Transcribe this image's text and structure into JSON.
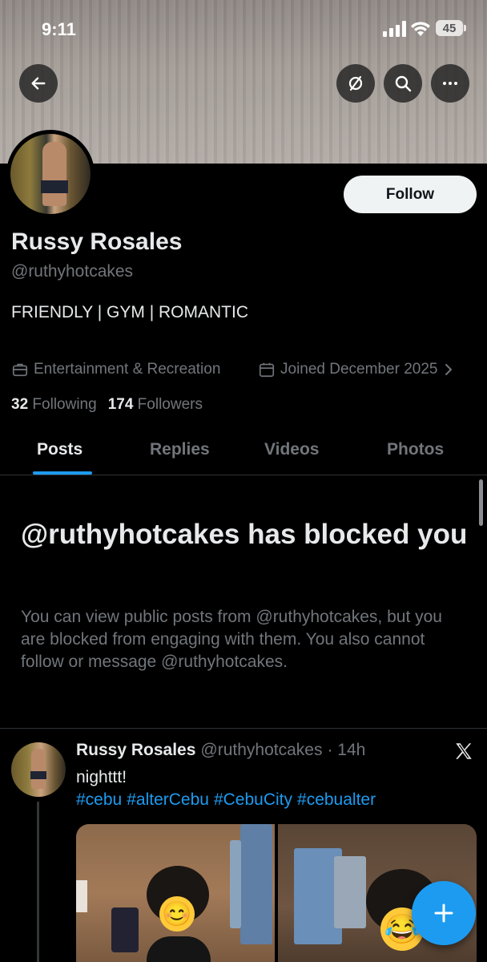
{
  "status_bar": {
    "time": "9:11",
    "battery": "45"
  },
  "profile": {
    "name": "Russy Rosales",
    "handle": "@ruthyhotcakes",
    "bio": "FRIENDLY | GYM | ROMANTIC",
    "category": "Entertainment & Recreation",
    "joined": "Joined December 2025",
    "following_count": "32",
    "following_label": "Following",
    "followers_count": "174",
    "followers_label": "Followers",
    "follow_button": "Follow"
  },
  "tabs": [
    {
      "label": "Posts",
      "active": true
    },
    {
      "label": "Replies",
      "active": false
    },
    {
      "label": "Videos",
      "active": false
    },
    {
      "label": "Photos",
      "active": false
    }
  ],
  "blocked_notice": {
    "title": "@ruthyhotcakes has blocked you",
    "description": "You can view public posts from @ruthyhotcakes, but you are blocked from engaging with them. You also cannot follow or message @ruthyhotcakes."
  },
  "post": {
    "name": "Russy Rosales",
    "handle": "@ruthyhotcakes",
    "time": "· 14h",
    "text": "nighttt!",
    "hashtags": [
      "#cebu",
      "#alterCebu",
      "#CebuCity",
      "#cebualter"
    ],
    "media_emojis": [
      "😊",
      "😂"
    ]
  },
  "icons": {
    "back": "arrow-left-icon",
    "grok": "grok-icon",
    "search": "search-icon",
    "more": "more-icon",
    "category": "briefcase-icon",
    "calendar": "calendar-icon",
    "chevron": "chevron-right-icon",
    "x_logo": "x-logo-icon",
    "compose": "plus-icon"
  },
  "colors": {
    "accent": "#1d9bf0",
    "background": "#000000",
    "muted_text": "#71767b"
  }
}
